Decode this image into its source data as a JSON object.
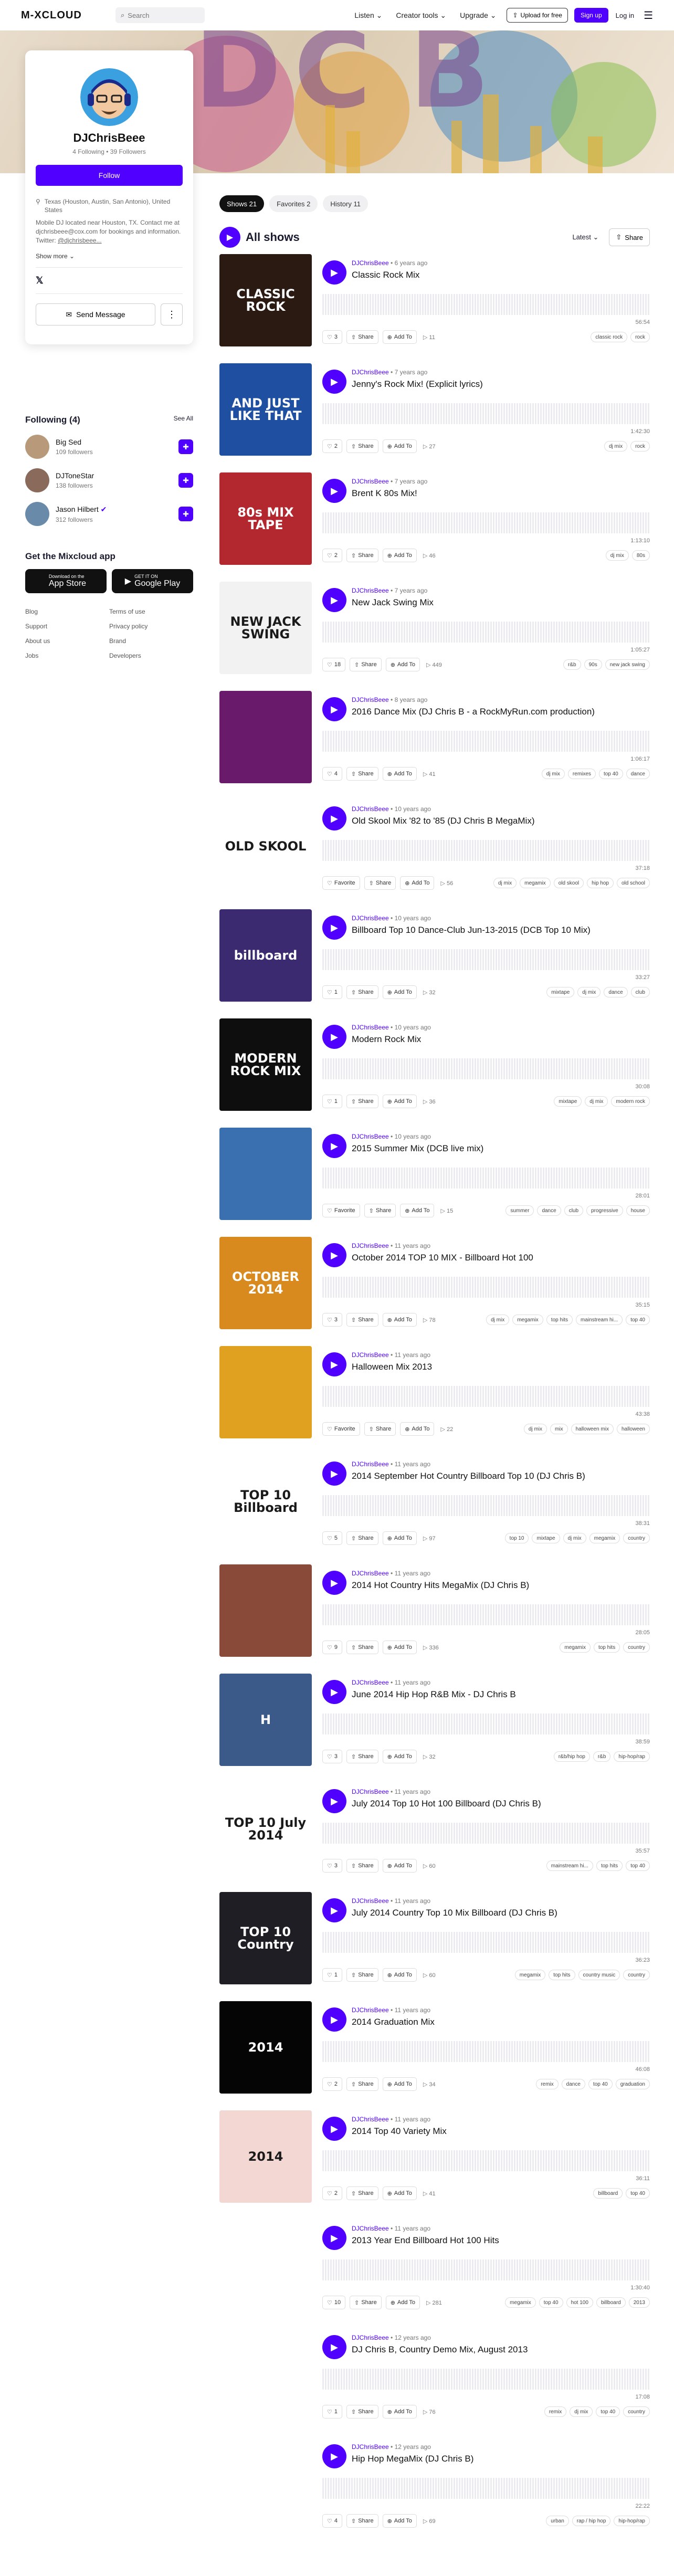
{
  "nav": {
    "logo": "M-XCLOUD",
    "search_placeholder": "Search",
    "links": [
      "Listen",
      "Creator tools",
      "Upgrade"
    ],
    "upload": "Upload for free",
    "signup": "Sign up",
    "login": "Log in"
  },
  "profile": {
    "name": "DJChrisBeee",
    "following_count": "4 Following",
    "followers_count": "39 Followers",
    "follow_label": "Follow",
    "location": "Texas (Houston, Austin, San Antonio), United States",
    "bio": "Mobile DJ located near Houston, TX. Contact me at djchrisbeee@cox.com for bookings and information.",
    "twitter_prefix": "Twitter:",
    "twitter_handle": "@djchrisbeee...",
    "show_more": "Show more",
    "send_message": "Send Message"
  },
  "following": {
    "title": "Following (4)",
    "see_all": "See All",
    "items": [
      {
        "name": "Big Sed",
        "count": "109 followers"
      },
      {
        "name": "DJToneStar",
        "count": "138 followers"
      },
      {
        "name": "Jason Hilbert",
        "count": "312 followers"
      }
    ]
  },
  "apps": {
    "title": "Get the Mixcloud app",
    "appstore_small": "Download on the",
    "appstore": "App Store",
    "google_small": "GET IT ON",
    "google": "Google Play"
  },
  "footer_links": [
    "Blog",
    "Terms of use",
    "Support",
    "Privacy policy",
    "About us",
    "Brand",
    "Jobs",
    "Developers"
  ],
  "tabs": [
    {
      "label": "Shows 21"
    },
    {
      "label": "Favorites 2"
    },
    {
      "label": "History 11"
    }
  ],
  "all_shows": {
    "title": "All shows",
    "sort": "Latest",
    "share": "Share"
  },
  "actions": {
    "share": "Share",
    "add_to": "Add To"
  },
  "shows": [
    {
      "owner": "DJChrisBeee",
      "age": "6 years ago",
      "title": "Classic Rock Mix",
      "duration": "56:54",
      "favorites": "3",
      "plays": "11",
      "tags": [
        "classic rock",
        "rock"
      ],
      "thumb": "CLASSIC ROCK",
      "color": "#2a1a12"
    },
    {
      "owner": "DJChrisBeee",
      "age": "7 years ago",
      "title": "Jenny's Rock Mix! (Explicit lyrics)",
      "duration": "1:42:30",
      "favorites": "2",
      "plays": "27",
      "tags": [
        "dj mix",
        "rock"
      ],
      "thumb": "AND JUST LIKE THAT",
      "color": "#1e4fa0"
    },
    {
      "owner": "DJChrisBeee",
      "age": "7 years ago",
      "title": "Brent K 80s Mix!",
      "duration": "1:13:10",
      "favorites": "2",
      "plays": "46",
      "tags": [
        "dj mix",
        "80s"
      ],
      "thumb": "80s MIX TAPE",
      "color": "#b2282e"
    },
    {
      "owner": "DJChrisBeee",
      "age": "7 years ago",
      "title": "New Jack Swing Mix",
      "duration": "1:05:27",
      "favorites": "18",
      "plays": "449",
      "tags": [
        "r&b",
        "90s",
        "new jack swing"
      ],
      "thumb": "NEW JACK SWING",
      "color": "#f2f2f2"
    },
    {
      "owner": "DJChrisBeee",
      "age": "8 years ago",
      "title": "2016 Dance Mix (DJ Chris B - a RockMyRun.com production)",
      "duration": "1:06:17",
      "favorites": "4",
      "plays": "41",
      "tags": [
        "dj mix",
        "remixes",
        "top 40",
        "dance"
      ],
      "thumb": "",
      "color": "#6a1a6a"
    },
    {
      "owner": "DJChrisBeee",
      "age": "10 years ago",
      "title": "Old Skool Mix '82 to '85 (DJ Chris B MegaMix)",
      "duration": "37:18",
      "favorites": "Favorite",
      "plays": "56",
      "tags": [
        "dj mix",
        "megamix",
        "old skool",
        "hip hop",
        "old school"
      ],
      "thumb": "OLD SKOOL",
      "color": "#ffffff"
    },
    {
      "owner": "DJChrisBeee",
      "age": "10 years ago",
      "title": "Billboard Top 10 Dance-Club Jun-13-2015 (DCB Top 10 Mix)",
      "duration": "33:27",
      "favorites": "1",
      "plays": "32",
      "tags": [
        "mixtape",
        "dj mix",
        "dance",
        "club"
      ],
      "thumb": "billboard",
      "color": "#3c2a70"
    },
    {
      "owner": "DJChrisBeee",
      "age": "10 years ago",
      "title": "Modern Rock Mix",
      "duration": "30:08",
      "favorites": "1",
      "plays": "36",
      "tags": [
        "mixtape",
        "dj mix",
        "modern rock"
      ],
      "thumb": "MODERN ROCK MIX",
      "color": "#0e0e0e"
    },
    {
      "owner": "DJChrisBeee",
      "age": "10 years ago",
      "title": "2015 Summer Mix (DCB live mix)",
      "duration": "28:01",
      "favorites": "Favorite",
      "plays": "15",
      "tags": [
        "summer",
        "dance",
        "club",
        "progressive",
        "house"
      ],
      "thumb": "",
      "color": "#3a6fb0"
    },
    {
      "owner": "DJChrisBeee",
      "age": "11 years ago",
      "title": "October 2014 TOP 10 MIX - Billboard Hot 100",
      "duration": "35:15",
      "favorites": "3",
      "plays": "78",
      "tags": [
        "dj mix",
        "megamix",
        "top hits",
        "mainstream hi...",
        "top 40"
      ],
      "thumb": "OCTOBER 2014",
      "color": "#d88a1e"
    },
    {
      "owner": "DJChrisBeee",
      "age": "11 years ago",
      "title": "Halloween Mix 2013",
      "duration": "43:38",
      "favorites": "Favorite",
      "plays": "22",
      "tags": [
        "dj mix",
        "mix",
        "halloween mix",
        "halloween"
      ],
      "thumb": "",
      "color": "#e0a020"
    },
    {
      "owner": "DJChrisBeee",
      "age": "11 years ago",
      "title": "2014 September Hot Country Billboard Top 10 (DJ Chris B)",
      "duration": "38:31",
      "favorites": "5",
      "plays": "97",
      "tags": [
        "top 10",
        "mixtape",
        "dj mix",
        "megamix",
        "country"
      ],
      "thumb": "TOP 10 Billboard",
      "color": "#ffffff"
    },
    {
      "owner": "DJChrisBeee",
      "age": "11 years ago",
      "title": "2014 Hot Country Hits MegaMix (DJ Chris B)",
      "duration": "28:05",
      "favorites": "9",
      "plays": "336",
      "tags": [
        "megamix",
        "top hits",
        "country"
      ],
      "thumb": "",
      "color": "#8a4a3a"
    },
    {
      "owner": "DJChrisBeee",
      "age": "11 years ago",
      "title": "June 2014 Hip Hop R&B Mix - DJ Chris B",
      "duration": "38:59",
      "favorites": "3",
      "plays": "32",
      "tags": [
        "r&b/hip hop",
        "r&b",
        "hip-hop/rap"
      ],
      "thumb": "H",
      "color": "#3b5a8a"
    },
    {
      "owner": "DJChrisBeee",
      "age": "11 years ago",
      "title": "July 2014 Top 10 Hot 100 Billboard (DJ Chris B)",
      "duration": "35:57",
      "favorites": "3",
      "plays": "60",
      "tags": [
        "mainstream hi...",
        "top hits",
        "top 40"
      ],
      "thumb": "TOP 10 July 2014",
      "color": "#ffffff"
    },
    {
      "owner": "DJChrisBeee",
      "age": "11 years ago",
      "title": "July 2014 Country Top 10 Mix Billboard (DJ Chris B)",
      "duration": "36:23",
      "favorites": "1",
      "plays": "60",
      "tags": [
        "megamix",
        "top hits",
        "country music",
        "country"
      ],
      "thumb": "TOP 10 Country",
      "color": "#1e1e24"
    },
    {
      "owner": "DJChrisBeee",
      "age": "11 years ago",
      "title": "2014 Graduation Mix",
      "duration": "46:08",
      "favorites": "2",
      "plays": "34",
      "tags": [
        "remix",
        "dance",
        "top 40",
        "graduation"
      ],
      "thumb": "2014",
      "color": "#050505"
    },
    {
      "owner": "DJChrisBeee",
      "age": "11 years ago",
      "title": "2014 Top 40 Variety Mix",
      "duration": "36:11",
      "favorites": "2",
      "plays": "41",
      "tags": [
        "billboard",
        "top 40"
      ],
      "thumb": "2014",
      "color": "#f2d7d2"
    },
    {
      "owner": "DJChrisBeee",
      "age": "11 years ago",
      "title": "2013 Year End Billboard Hot 100 Hits",
      "duration": "1:30:40",
      "favorites": "10",
      "plays": "281",
      "tags": [
        "megamix",
        "top 40",
        "hot 100",
        "billboard",
        "2013"
      ],
      "thumb": "",
      "color": "#ffffff"
    },
    {
      "owner": "DJChrisBeee",
      "age": "12 years ago",
      "title": "DJ Chris B, Country Demo Mix, August 2013",
      "duration": "17:08",
      "favorites": "1",
      "plays": "76",
      "tags": [
        "remix",
        "dj mix",
        "top 40",
        "country"
      ],
      "thumb": "",
      "color": "#ffffff"
    },
    {
      "owner": "DJChrisBeee",
      "age": "12 years ago",
      "title": "Hip Hop MegaMix (DJ Chris B)",
      "duration": "22:22",
      "favorites": "4",
      "plays": "69",
      "tags": [
        "urban",
        "rap / hip hop",
        "hip-hop/rap"
      ],
      "thumb": "",
      "color": "#ffffff"
    }
  ]
}
